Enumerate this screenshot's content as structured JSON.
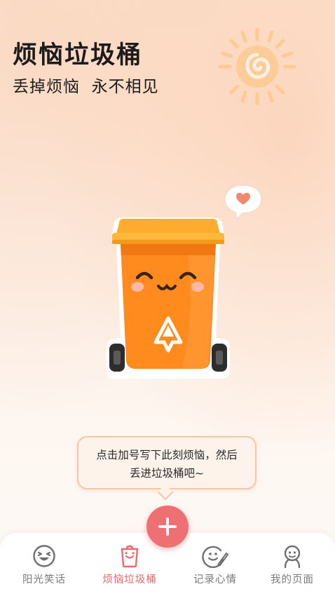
{
  "header": {
    "title": "烦恼垃圾桶",
    "subtitle": "丢掉烦恼  永不相见"
  },
  "tip": {
    "text_line1": "点击加号写下此刻烦恼，然后",
    "text_line2": "丢进垃圾桶吧~"
  },
  "fab": {
    "icon": "plus-icon"
  },
  "tabbar": {
    "tabs": [
      {
        "label": "阳光笑话",
        "icon": "laughing-face-icon",
        "active": false
      },
      {
        "label": "烦恼垃圾桶",
        "icon": "trash-can-icon",
        "active": true
      },
      {
        "label": "记录心情",
        "icon": "mood-edit-icon",
        "active": false
      },
      {
        "label": "我的页面",
        "icon": "profile-icon",
        "active": false
      }
    ]
  },
  "colors": {
    "accent": "#ef7072",
    "bin_orange": "#ff8a1e",
    "bin_lid": "#ffb43c",
    "sun": "#fbc27a"
  }
}
